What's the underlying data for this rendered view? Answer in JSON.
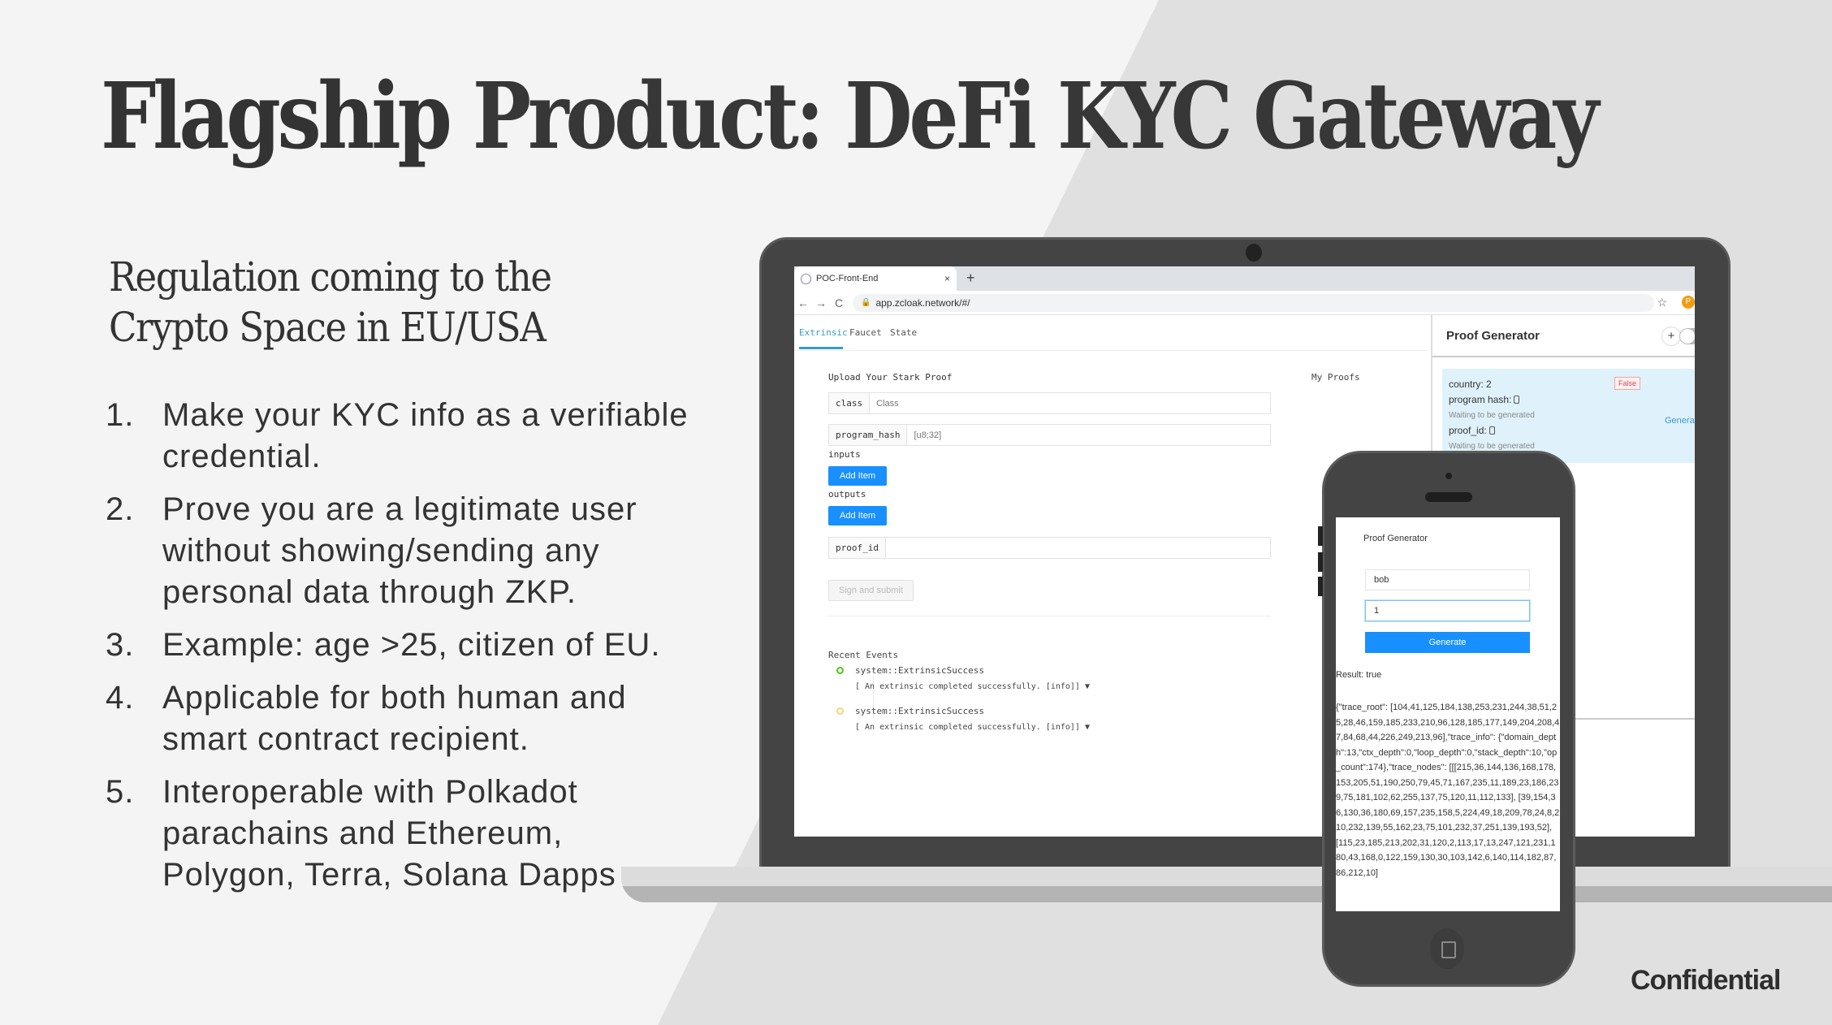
{
  "slide": {
    "title_bold": "Flagship",
    "title_rest": "Product: DeFi KYC Gateway",
    "subtitle_line1": "Regulation coming to the",
    "subtitle_line2": "Crypto Space in EU/USA",
    "bullets": [
      {
        "num": "1.",
        "text": "Make your KYC info as a verifiable credential."
      },
      {
        "num": "2.",
        "text": "Prove you are a legitimate user without showing/sending any personal data through ZKP."
      },
      {
        "num": "3.",
        "text": "Example: age >25, citizen of EU."
      },
      {
        "num": "4.",
        "text": "Applicable for both human and smart contract recipient."
      },
      {
        "num": "5.",
        "text": "Interoperable with Polkadot parachains and Ethereum, Polygon, Terra, Solana Dapps"
      }
    ],
    "footer": "Confidential"
  },
  "browser": {
    "tab_title": "POC-Front-End",
    "tab_close": "×",
    "new_tab": "+",
    "back": "←",
    "forward": "→",
    "reload": "C",
    "url": "app.zcloak.network/#/",
    "star": "☆",
    "extension": "P"
  },
  "app": {
    "tabs": [
      {
        "label": "Extrinsic",
        "active": true
      },
      {
        "label": "Faucet",
        "active": false
      },
      {
        "label": "State",
        "active": false
      }
    ],
    "form": {
      "title": "Upload Your Stark Proof",
      "class_label": "class",
      "class_placeholder": "Class",
      "program_hash_label": "program_hash",
      "program_hash_placeholder": "[u8;32]",
      "inputs_label": "inputs",
      "outputs_label": "outputs",
      "add_item": "Add Item",
      "proof_id_label": "proof_id",
      "proof_id_value": "",
      "submit": "Sign and submit"
    },
    "my_proofs": "My Proofs",
    "recent_events": {
      "title": "Recent Events",
      "items": [
        {
          "name": "system::ExtrinsicSuccess",
          "detail": "[ An extrinsic completed successfully. [info]]",
          "status": "success"
        },
        {
          "name": "system::ExtrinsicSuccess",
          "detail": "[ An extrinsic completed successfully. [info]]",
          "status": "pending"
        }
      ]
    },
    "proof_generator": {
      "title": "Proof Generator",
      "plus": "+",
      "country": "country: 2",
      "status": "False",
      "program_hash": "program hash:",
      "waiting": "Waiting to be generated",
      "proof_id": "proof_id:",
      "generate_link": "Generate"
    }
  },
  "phone": {
    "title": "Proof Generator",
    "name_value": "bob",
    "number_value": "1",
    "generate": "Generate",
    "result": "Result: true",
    "json": "{\"trace_root\": [104,41,125,184,138,253,231,244,38,51,25,28,46,159,185,233,210,96,128,185,177,149,204,208,47,84,68,44,226,249,213,96],\"trace_info\": {\"domain_depth\":13,\"ctx_depth\":0,\"loop_depth\":0,\"stack_depth\":10,\"op_count\":174},\"trace_nodes\": [[[215,36,144,136,168,178,153,205,51,190,250,79,45,71,167,235,11,189,23,186,239,75,181,102,62,255,137,75,120,11,112,133], [39,154,36,130,36,180,69,157,235,158,5,224,49,18,209,78,24,8,210,232,139,55,162,23,75,101,232,37,251,139,193,52], [115,23,185,213,202,31,120,2,113,17,13,247,121,231,180,43,168,0,122,159,130,30,103,142,6,140,114,182,87,86,212,10]"
  },
  "colors": {
    "accent_blue": "#1890ff",
    "tab_active": "#3a9bc8",
    "success_green": "#52c41a",
    "false_red": "#e0405a",
    "card_bg": "#dff2fb",
    "device_gray": "#444444"
  }
}
